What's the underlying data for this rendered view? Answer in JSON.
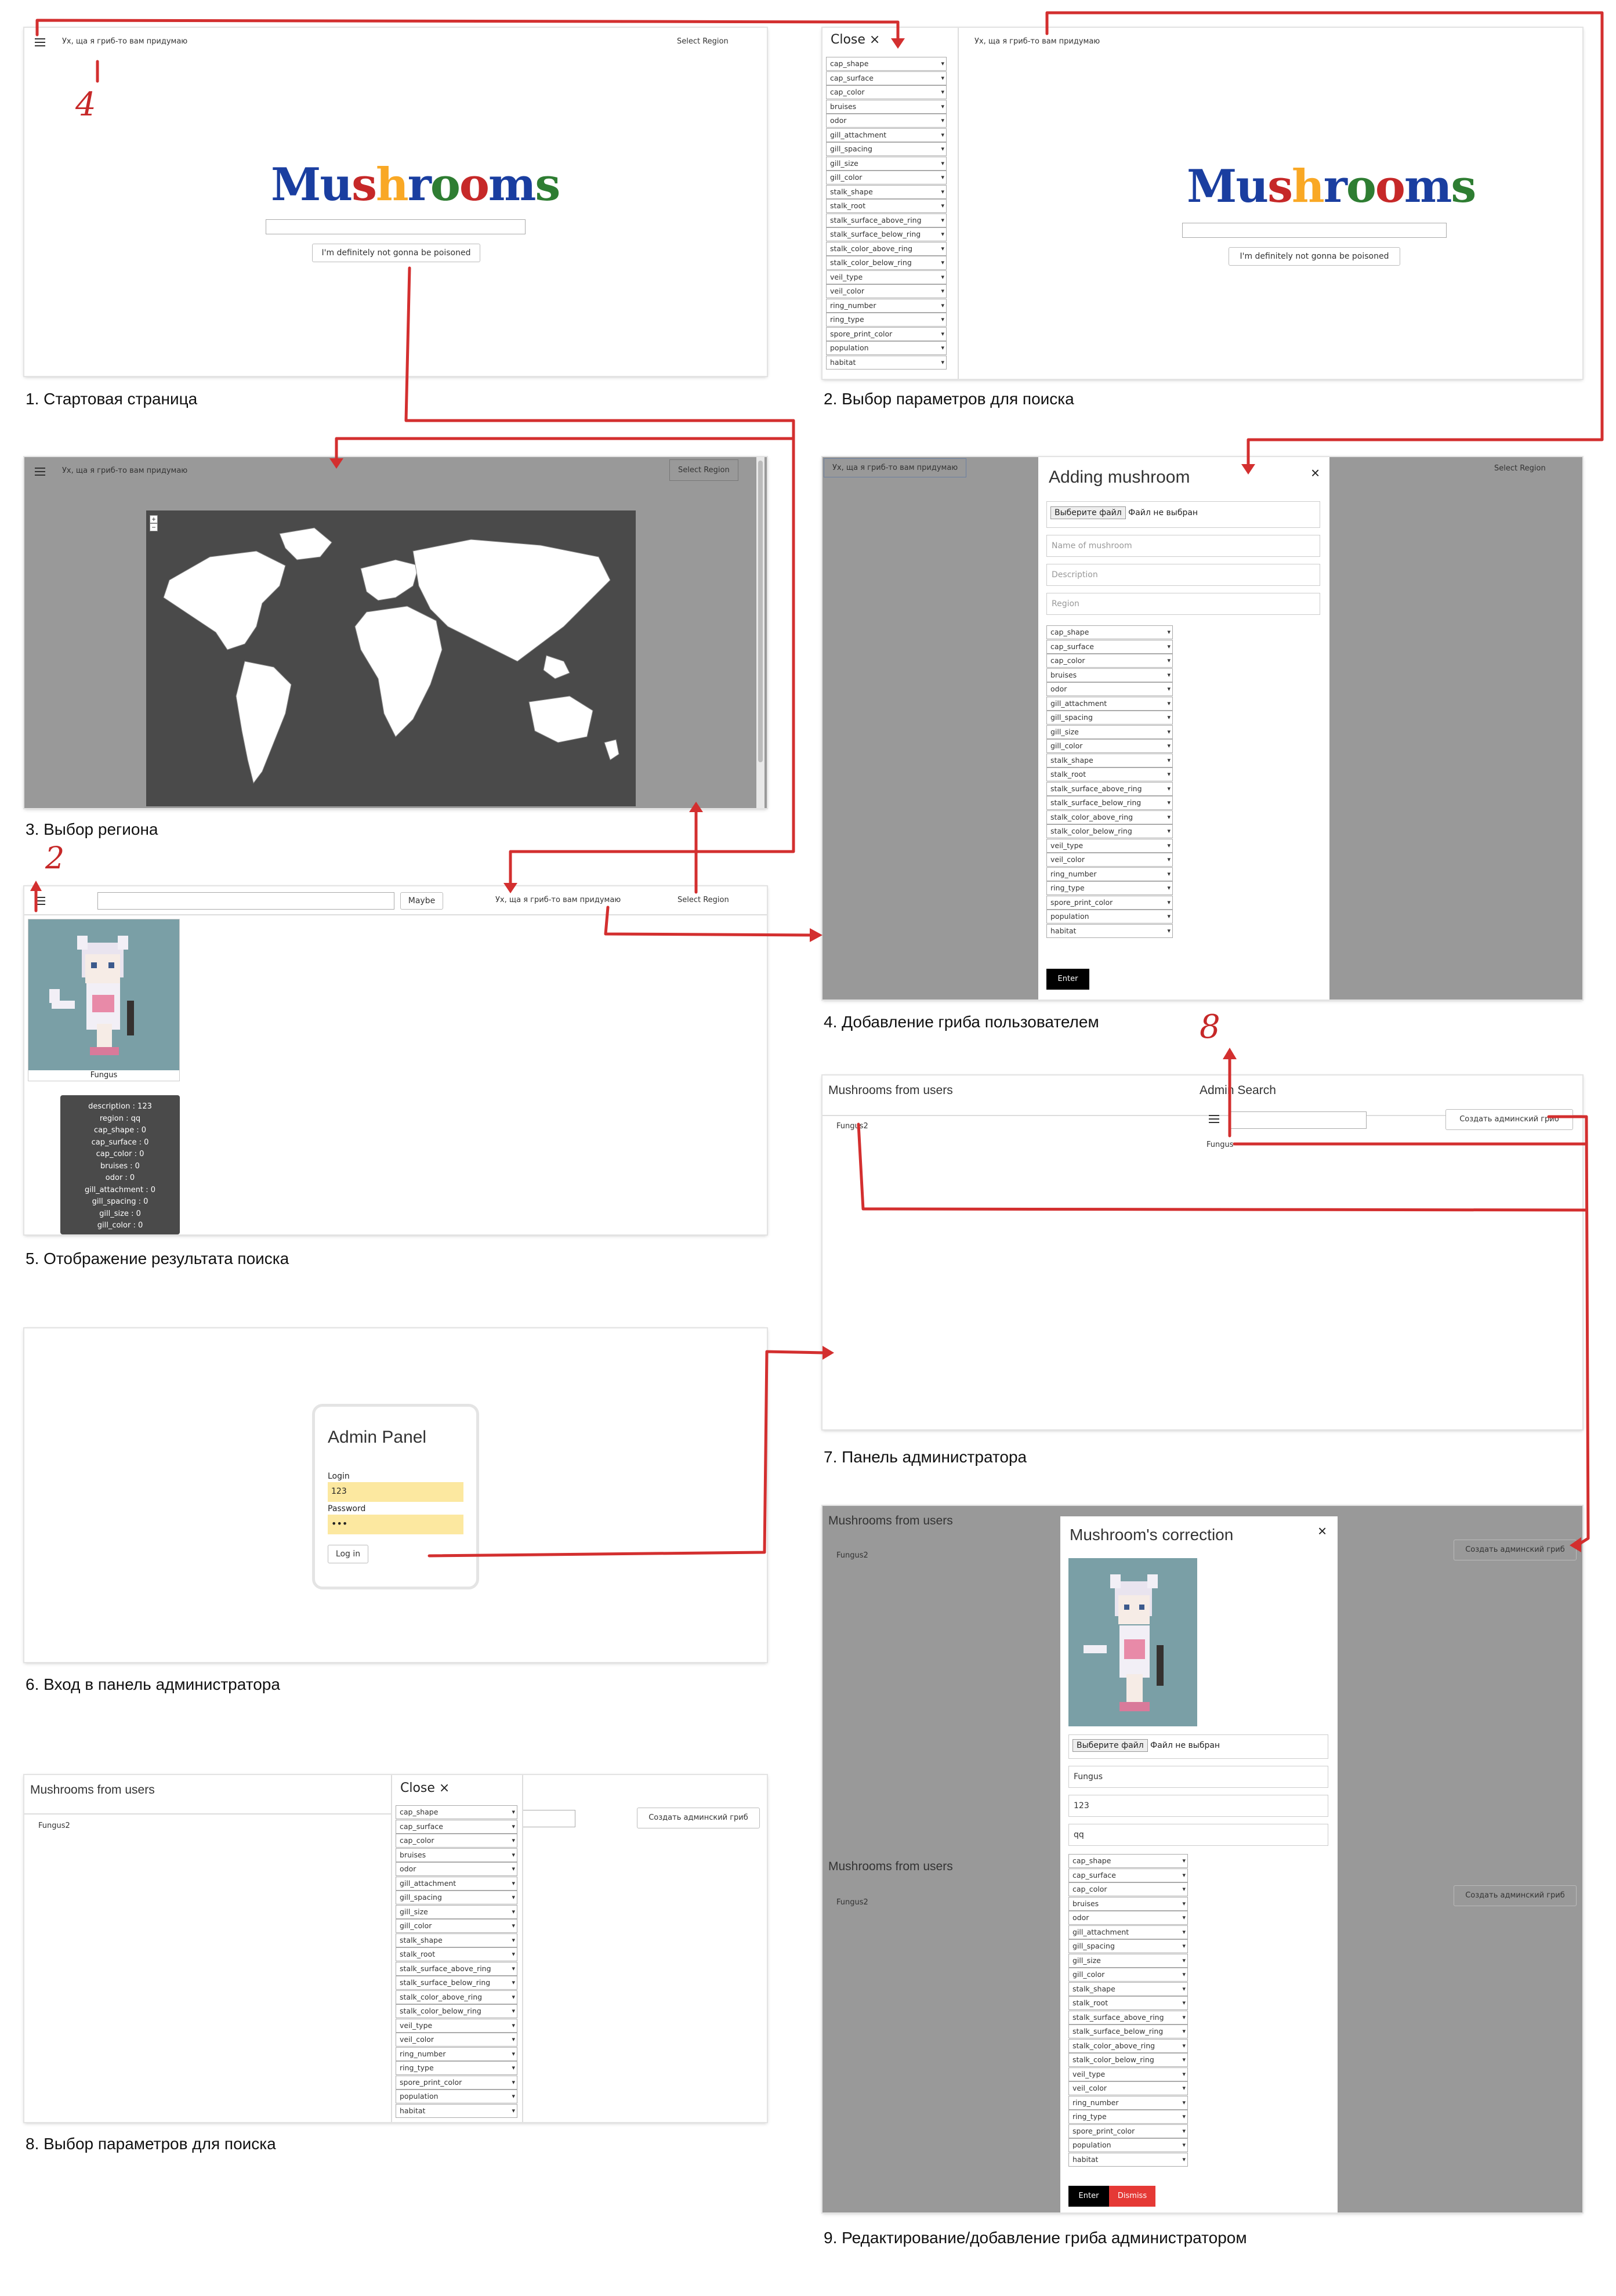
{
  "params": [
    "cap_shape",
    "cap_surface",
    "cap_color",
    "bruises",
    "odor",
    "gill_attachment",
    "gill_spacing",
    "gill_size",
    "gill_color",
    "stalk_shape",
    "stalk_root",
    "stalk_surface_above_ring",
    "stalk_surface_below_ring",
    "stalk_color_above_ring",
    "stalk_color_below_ring",
    "veil_type",
    "veil_color",
    "ring_number",
    "ring_type",
    "spore_print_color",
    "population",
    "habitat"
  ],
  "common": {
    "app_subtitle": "Ух, ща я гриб-то вам придумаю",
    "select_region": "Select Region",
    "logo": "Mushrooms",
    "search_button": "I'm definitely not gonna be poisoned",
    "close": "Close ×",
    "maybe": "Maybe"
  },
  "s1": {
    "caption": "1. Стартовая страница",
    "note": "4"
  },
  "s2": {
    "caption": "2. Выбор параметров для поиска"
  },
  "s3": {
    "caption": "3. Выбор региона",
    "zoom_in": "+",
    "zoom_out": "−"
  },
  "s4": {
    "caption": "4. Добавление гриба пользователем",
    "title": "Adding mushroom",
    "close": "×",
    "file_button": "Выберите файл",
    "file_text": "Файл не выбран",
    "name_ph": "Name of mushroom",
    "desc_ph": "Description",
    "region_ph": "Region",
    "enter": "Enter"
  },
  "s5": {
    "caption": "5. Отображение результата поиска",
    "note": "2",
    "card_label": "Fungus",
    "details": [
      "description : 123",
      "region : qq",
      "cap_shape : 0",
      "cap_surface : 0",
      "cap_color : 0",
      "bruises : 0",
      "odor : 0",
      "gill_attachment : 0",
      "gill_spacing : 0",
      "gill_size : 0",
      "gill_color : 0"
    ]
  },
  "s6": {
    "caption": "6. Вход в панель администратора",
    "title": "Admin Panel",
    "login_label": "Login",
    "login_value": "123",
    "password_label": "Password",
    "password_value": "•••",
    "login_button": "Log in"
  },
  "s7": {
    "caption": "7. Панель администратора",
    "users_title": "Mushrooms from users",
    "user_item": "Fungus2",
    "admin_title": "Admin Search",
    "admin_item": "Fungus",
    "create_button": "Создать админский гриб",
    "note": "8"
  },
  "s8": {
    "caption": "8. Выбор параметров для поиска"
  },
  "s9": {
    "caption": "9. Редактирование/добавление гриба администратором",
    "title": "Mushroom's correction",
    "close": "×",
    "name_value": "Fungus",
    "desc_value": "123",
    "region_value": "qq",
    "enter": "Enter",
    "dismiss": "Dismiss"
  }
}
